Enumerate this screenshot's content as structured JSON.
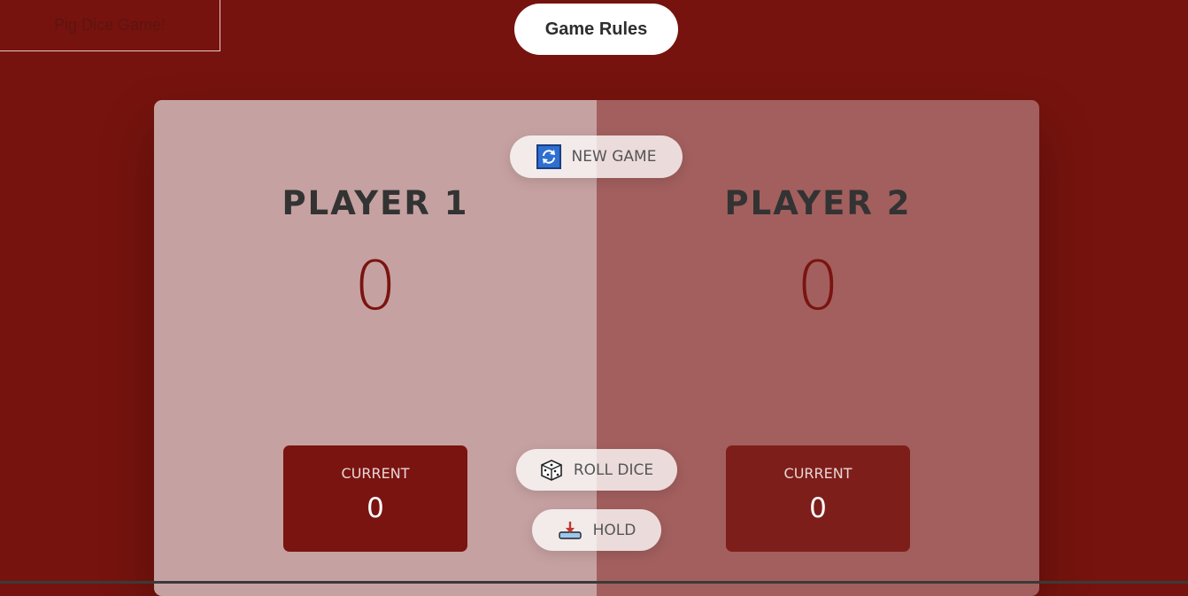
{
  "header": {
    "title": "Pig Dice Game!",
    "rules_button": "Game Rules"
  },
  "players": [
    {
      "name": "PLAYER 1",
      "score": "0",
      "current_label": "CURRENT",
      "current_score": "0"
    },
    {
      "name": "PLAYER 2",
      "score": "0",
      "current_label": "CURRENT",
      "current_score": "0"
    }
  ],
  "controls": {
    "new_game": {
      "label": "NEW GAME",
      "icon": "refresh-icon"
    },
    "roll_dice": {
      "label": "ROLL DICE",
      "icon": "dice-icon"
    },
    "hold": {
      "label": "HOLD",
      "icon": "hold-icon"
    }
  },
  "colors": {
    "background": "#76130e",
    "accent": "#7a1410"
  }
}
